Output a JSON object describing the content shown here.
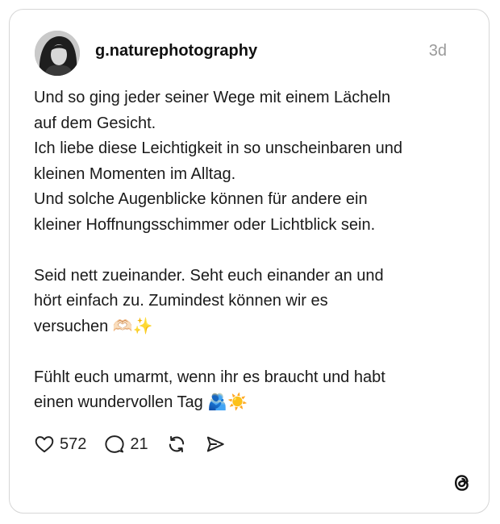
{
  "post": {
    "username": "g.naturephotography",
    "time": "3d",
    "paragraphs": [
      "Und so ging jeder seiner Wege mit einem Lächeln\nauf dem Gesicht.\nIch liebe diese Leichtigkeit in so unscheinbaren und\nkleinen Momenten im Alltag.\nUnd solche Augenblicke können für andere ein\nkleiner Hoffnungsschimmer oder Lichtblick sein.",
      "Seid nett zueinander. Seht euch einander an und\nhört einfach zu. Zumindest können wir es\nversuchen 🫶🏻✨",
      "Fühlt euch umarmt, wenn ihr es braucht und habt\neinen wundervollen Tag 🫂☀️"
    ],
    "likes": "572",
    "replies": "21"
  },
  "icons": {
    "like": "heart-icon",
    "reply": "comment-icon",
    "repost": "repost-icon",
    "share": "send-icon",
    "brand": "threads-logo-icon"
  }
}
